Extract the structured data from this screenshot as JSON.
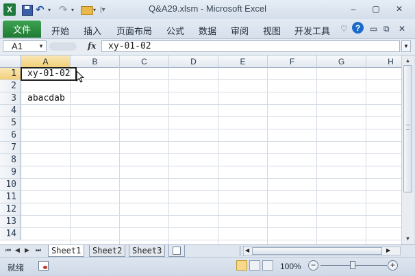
{
  "window": {
    "title": "Q&A29.xlsm  -  Microsoft Excel",
    "quick_access": [
      "excel-logo",
      "save-icon",
      "undo-icon",
      "redo-icon",
      "open-folder-icon"
    ],
    "controls": {
      "minimize": "–",
      "restore": "▢",
      "close": "✕"
    }
  },
  "ribbon": {
    "file_tab": "文件",
    "tabs": [
      "开始",
      "插入",
      "页面布局",
      "公式",
      "数据",
      "审阅",
      "视图",
      "开发工具"
    ],
    "icons": [
      "ribbon-collapse-icon",
      "help-icon",
      "minimize-ribbon-icon",
      "restore-window-icon",
      "close-window-icon"
    ]
  },
  "formula_bar": {
    "name_box": "A1",
    "fx_label": "fx",
    "formula": "xy-01-02"
  },
  "sheet": {
    "columns": [
      "A",
      "B",
      "C",
      "D",
      "E",
      "F",
      "G",
      "H"
    ],
    "rows": [
      "1",
      "2",
      "3",
      "4",
      "5",
      "6",
      "7",
      "8",
      "9",
      "10",
      "11",
      "12",
      "13",
      "14"
    ],
    "active_cell": "A1",
    "cells": {
      "A1": "xy-01-02",
      "A3": "abacdab"
    }
  },
  "sheet_tabs": [
    "Sheet1",
    "Sheet2",
    "Sheet3"
  ],
  "status": {
    "mode": "就绪",
    "zoom": "100%"
  },
  "colors": {
    "file_tab": "#2c8d45",
    "help": "#1b6ac9",
    "selected_header": "#f2d07a"
  }
}
